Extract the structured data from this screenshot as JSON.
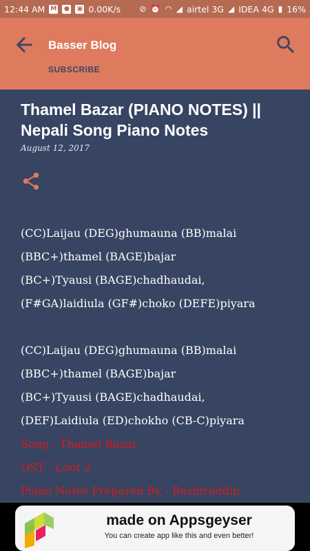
{
  "status_bar": {
    "time": "12:44 AM",
    "network_speed": "0.00K/s",
    "carrier1": "airtel 3G",
    "carrier2": "IDEA 4G",
    "battery": "16%"
  },
  "app_bar": {
    "title": "Basser Blog",
    "subscribe_label": "SUBSCRIBE",
    "back_icon": "arrow-left-icon",
    "search_icon": "search-icon",
    "color": "#de7a5d"
  },
  "post": {
    "title": "Thamel Bazar (PIANO NOTES) || Nepali Song Piano Notes",
    "date": "August 12, 2017",
    "share_icon": "share-icon",
    "verse1": [
      "(CC)Laijau (DEG)ghumauna (BB)malai",
      "(BBC+)thamel (BAGE)bajar",
      "(BC+)Tyausi (BAGE)chadhaudai,",
      "(F#GA)laidiula (GF#)choko (DEFE)piyara"
    ],
    "verse2": [
      "(CC)Laijau (DEG)ghumauna (BB)malai",
      "(BBC+)thamel (BAGE)bajar",
      "(BC+)Tyausi (BAGE)chadhaudai,",
      "(DEF)Laidiula (ED)chokho (CB-C)piyara"
    ],
    "credits": [
      "Song - Thamel Bazar",
      "OST - Loot 2",
      "Piano Notes Prepared By - Bashiruddin"
    ],
    "credit_color": "#d81b1b",
    "background": "#374462"
  },
  "ad": {
    "title": "made on Appsgeyser",
    "subtitle": "You can create app like this and even better!"
  }
}
